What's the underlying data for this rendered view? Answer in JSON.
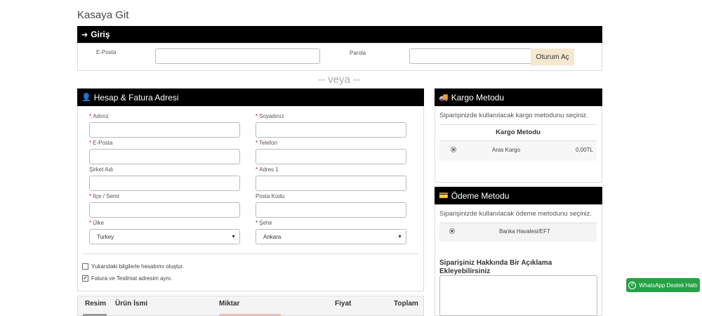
{
  "page": {
    "title": "Kasaya Git"
  },
  "login": {
    "header": "Giriş",
    "email_label": "E-Posta",
    "password_label": "Parola",
    "submit_label": "Oturum Aç"
  },
  "divider": {
    "text": "-- veya --"
  },
  "billing": {
    "header": "Hesap & Fatura Adresi",
    "fields": {
      "first_name": "Adınız",
      "last_name": "Soyadınız",
      "email": "E-Posta",
      "phone": "Telefon",
      "company": "Şirket Adı",
      "address1": "Adres 1",
      "district": "İlçe / Semt",
      "postcode": "Posta Kodu",
      "country": "Ülke",
      "city": "Şehir"
    },
    "country_value": "Turkey",
    "city_value": "Ankara",
    "create_account_label": "Yukarıdaki bilgilerle hesabımı oluştur.",
    "same_address_label": "Fatura ve Teslimat adresim aynı."
  },
  "cart": {
    "headers": {
      "image": "Resim",
      "name": "Ürün İsmi",
      "qty": "Miktar",
      "price": "Fiyat",
      "total": "Toplam"
    }
  },
  "shipping": {
    "header": "Kargo Metodu",
    "hint": "Siparişinizde kullanılacak kargo metodunu seçiniz.",
    "table_header": "Kargo Metodu",
    "option_name": "Aras Kargo",
    "option_price": "0,00TL"
  },
  "payment": {
    "header": "Ödeme Metodu",
    "hint": "Siparişinizde kullanılacak ödeme metodunu seçiniz.",
    "option_name": "Banka Havalesi/EFT"
  },
  "comment": {
    "label": "Siparişiniz Hakkında Bir Açıklama Ekleyebilirsiniz"
  },
  "whatsapp": {
    "label": "WhatsApp Destek Hattı",
    "color": "#25a244"
  }
}
